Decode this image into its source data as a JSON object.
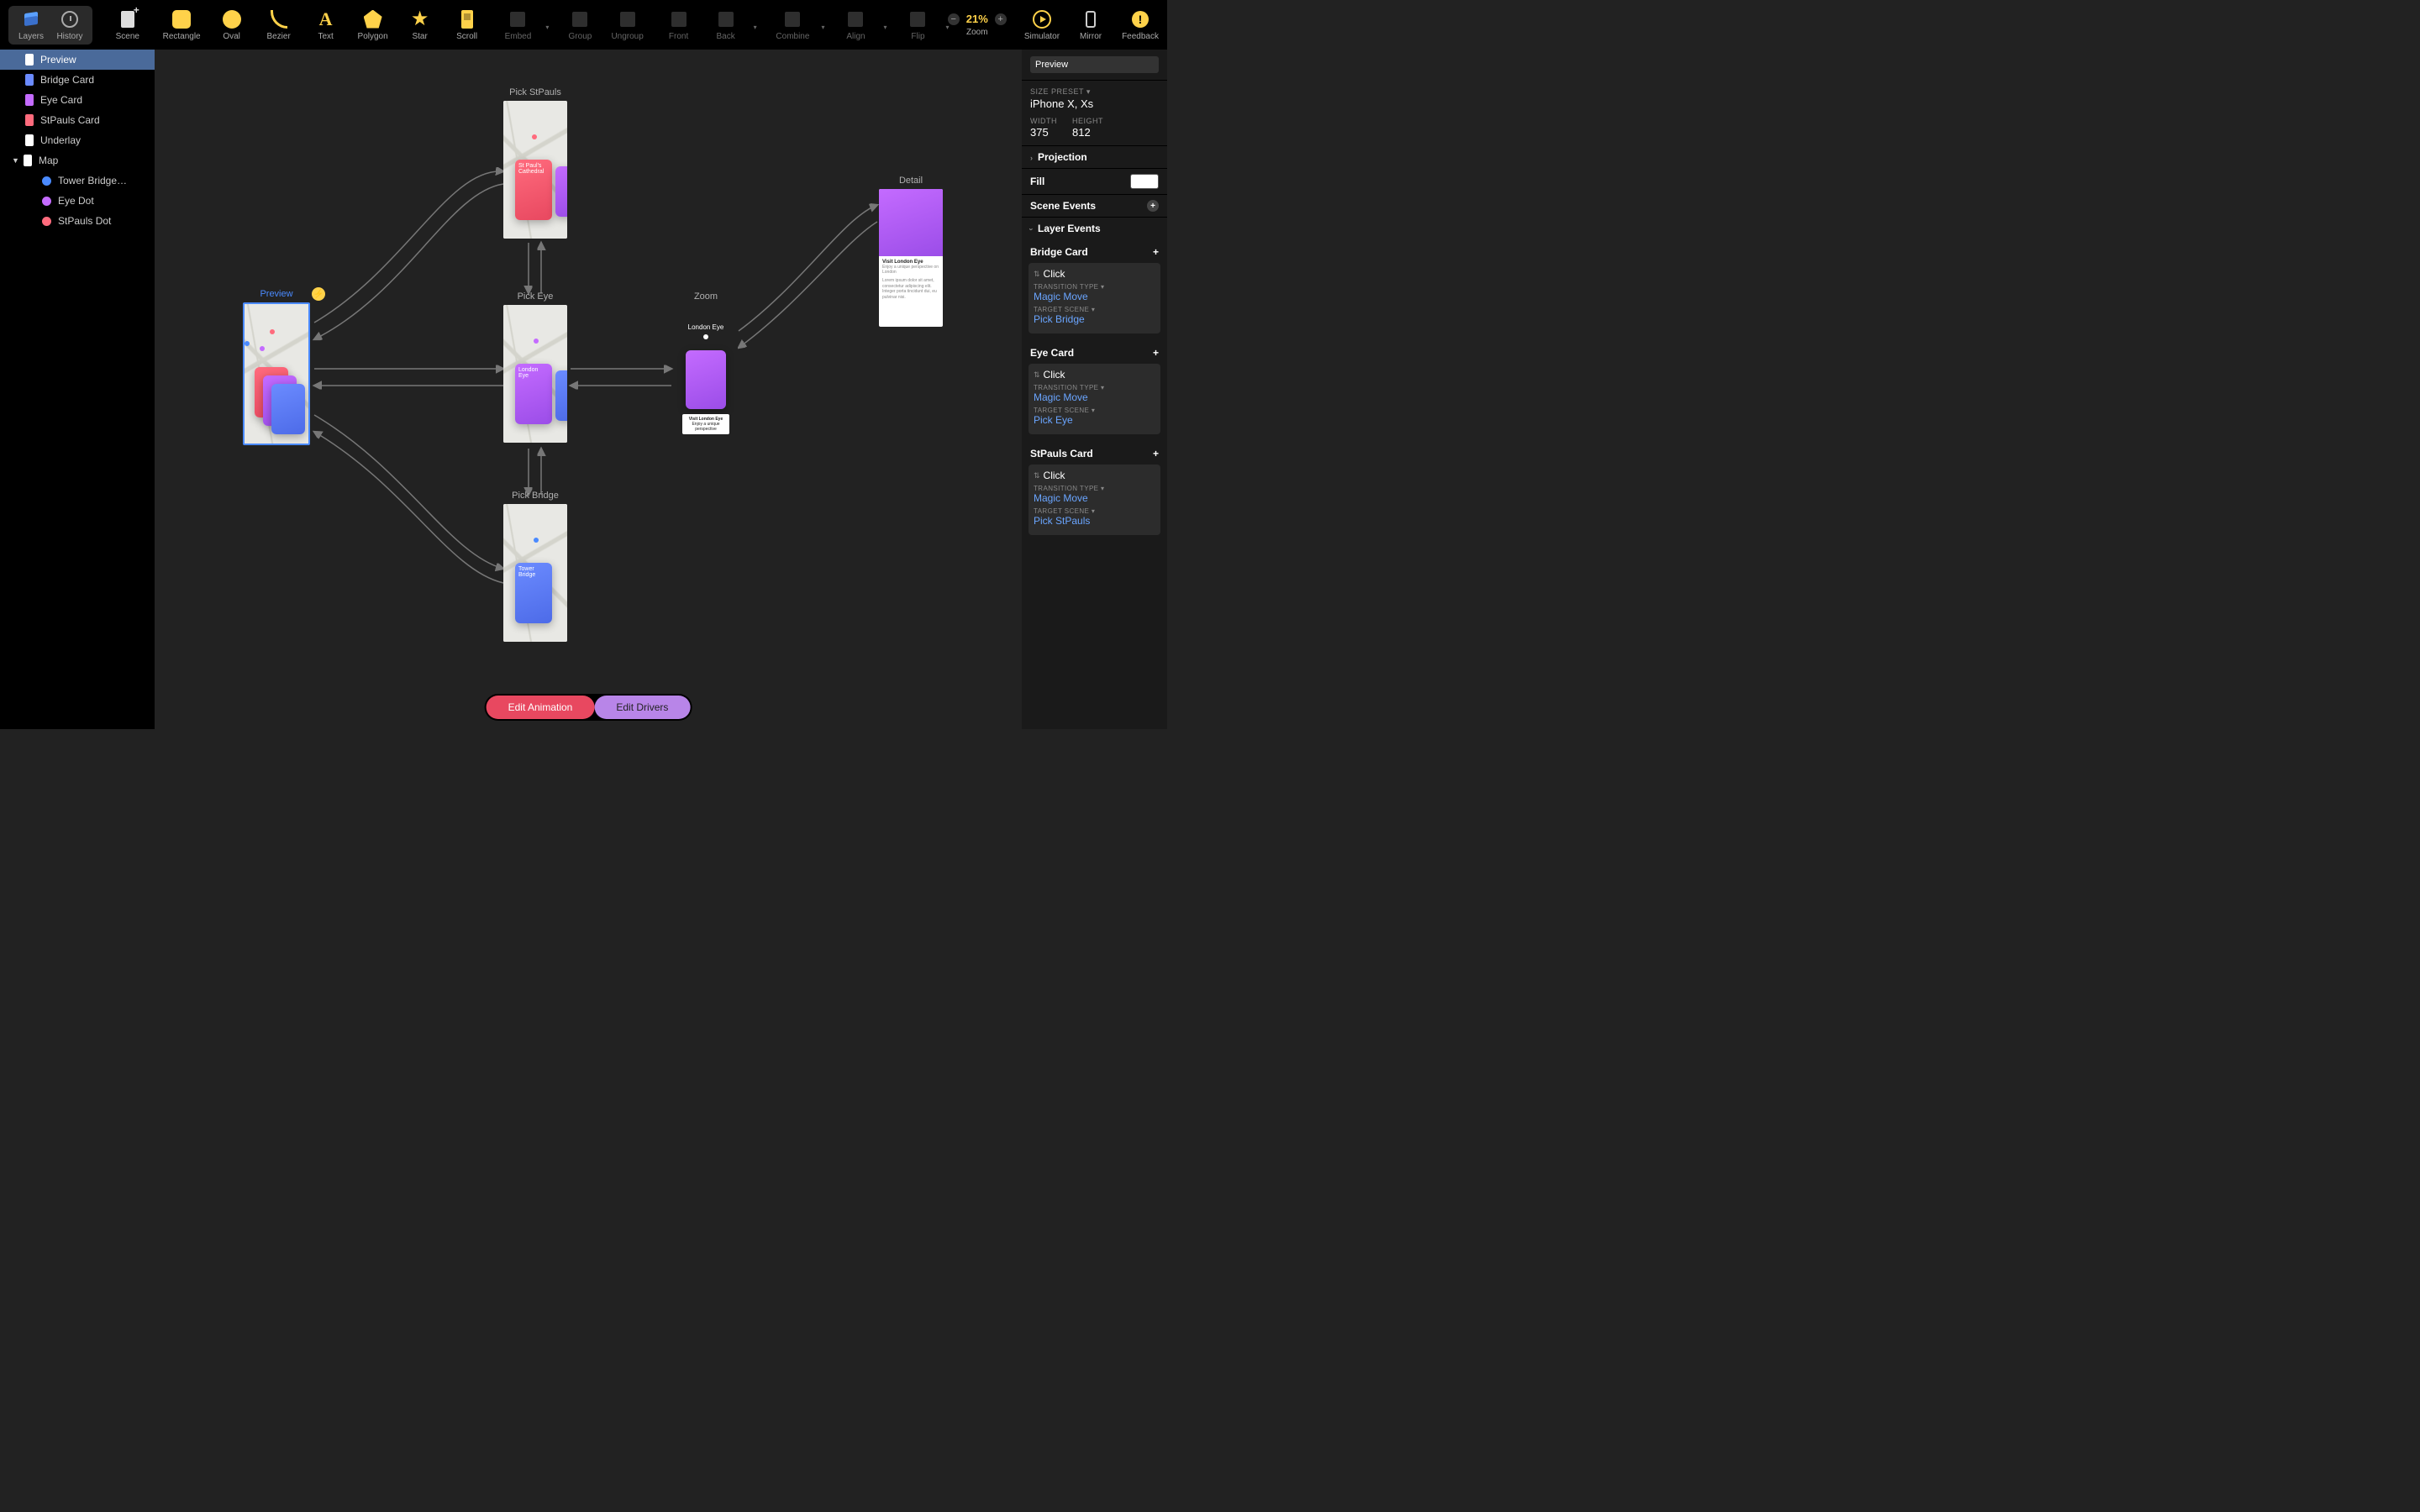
{
  "toolbar": {
    "layers": "Layers",
    "history": "History",
    "scene": "Scene",
    "rectangle": "Rectangle",
    "oval": "Oval",
    "bezier": "Bezier",
    "text": "Text",
    "polygon": "Polygon",
    "star": "Star",
    "scroll": "Scroll",
    "embed": "Embed",
    "group": "Group",
    "ungroup": "Ungroup",
    "front": "Front",
    "back": "Back",
    "combine": "Combine",
    "align": "Align",
    "flip": "Flip",
    "zoom_minus": "−",
    "zoom_value": "21%",
    "zoom_plus": "+",
    "zoom_label": "Zoom",
    "simulator": "Simulator",
    "mirror": "Mirror",
    "feedback": "Feedback",
    "feedback_glyph": "!"
  },
  "layers": {
    "items": [
      {
        "label": "Preview",
        "color": "#ffffff",
        "selected": true
      },
      {
        "label": "Bridge Card",
        "color": "#6b8bff"
      },
      {
        "label": "Eye Card",
        "color": "#c46bff"
      },
      {
        "label": "StPauls Card",
        "color": "#ff6b7d"
      },
      {
        "label": "Underlay",
        "color": "#ffffff"
      },
      {
        "label": "Map",
        "color": "#ffffff",
        "expanded": true
      },
      {
        "label": "Tower Bridge…",
        "dot": "#4a8aff",
        "child": true
      },
      {
        "label": "Eye Dot",
        "dot": "#c46bff",
        "child": true
      },
      {
        "label": "StPauls Dot",
        "dot": "#ff6b7d",
        "child": true
      }
    ]
  },
  "canvas": {
    "scenes": {
      "preview": {
        "label": "Preview",
        "bolt": "⚡"
      },
      "pick_stpauls": {
        "label": "Pick StPauls",
        "card_text": "St Paul's Cathedral"
      },
      "pick_eye": {
        "label": "Pick Eye",
        "card_text": "London Eye"
      },
      "pick_bridge": {
        "label": "Pick Bridge",
        "card_text": "Tower Bridge"
      },
      "zoom": {
        "label": "Zoom",
        "title": "London Eye",
        "btn": "Visit London Eye",
        "sub": "Enjoy a unique perspective"
      },
      "detail": {
        "label": "Detail",
        "title": "Visit London Eye",
        "sub": "Enjoy a unique perspective on London",
        "body": "Lorem ipsum dolor sit amet, consectetur adipiscing elit. Integer porta tincidunt dui, eu pulvinar nisi."
      }
    },
    "edit_animation": "Edit Animation",
    "edit_drivers": "Edit Drivers"
  },
  "right": {
    "title_value": "Preview",
    "size_preset_label": "SIZE PRESET",
    "size_preset_value": "iPhone X, Xs",
    "width_label": "WIDTH",
    "width_value": "375",
    "height_label": "HEIGHT",
    "height_value": "812",
    "projection": "Projection",
    "fill": "Fill",
    "scene_events": "Scene Events",
    "layer_events": "Layer Events",
    "event_groups": [
      {
        "name": "Bridge Card",
        "trigger": "Click",
        "transition_label": "TRANSITION TYPE",
        "transition_value": "Magic Move",
        "target_label": "TARGET SCENE",
        "target_value": "Pick Bridge"
      },
      {
        "name": "Eye Card",
        "trigger": "Click",
        "transition_label": "TRANSITION TYPE",
        "transition_value": "Magic Move",
        "target_label": "TARGET SCENE",
        "target_value": "Pick Eye"
      },
      {
        "name": "StPauls Card",
        "trigger": "Click",
        "transition_label": "TRANSITION TYPE",
        "transition_value": "Magic Move",
        "target_label": "TARGET SCENE",
        "target_value": "Pick StPauls"
      }
    ]
  }
}
